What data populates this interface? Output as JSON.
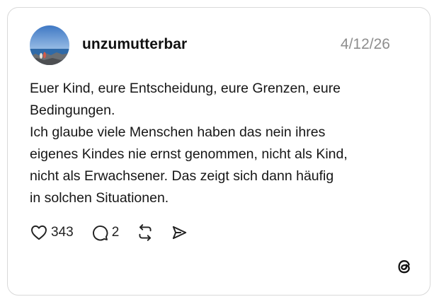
{
  "post": {
    "username": "unzumutterbar",
    "date": "4/12/26",
    "text": "Euer Kind, eure Entscheidung,  eure Grenzen, eure\nBedingungen.\nIch glaube viele Menschen haben das nein ihres\neigenes Kindes nie ernst genommen, nicht als Kind,\nnicht als Erwachsener. Das zeigt sich dann häufig\nin solchen Situationen."
  },
  "actions": {
    "like_icon": "heart-icon",
    "like_count": "343",
    "reply_icon": "speech-bubble-icon",
    "reply_count": "2",
    "repost_icon": "repost-icon",
    "share_icon": "send-icon"
  },
  "brand": {
    "logo_icon": "threads-logo-icon"
  },
  "colors": {
    "username": "#111111",
    "date": "#8e8e8e",
    "border": "#d9d9d9"
  }
}
